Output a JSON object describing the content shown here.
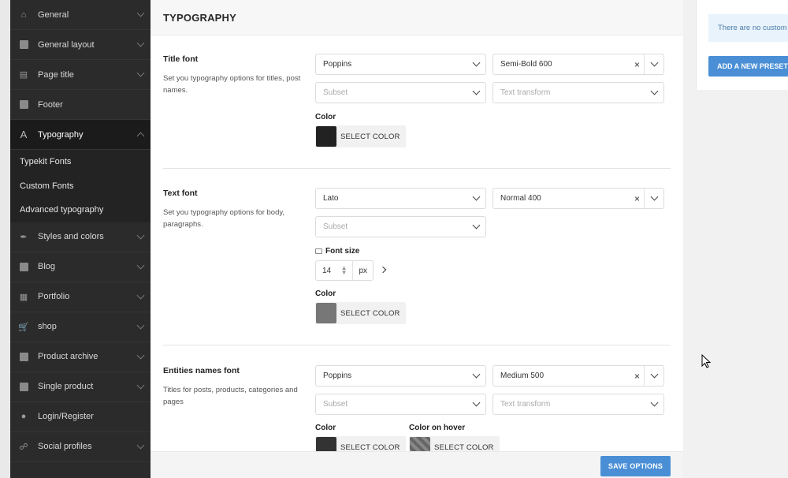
{
  "sidebar": {
    "items": [
      {
        "label": "General",
        "icon": "home-icon"
      },
      {
        "label": "General layout",
        "icon": "layout-icon"
      },
      {
        "label": "Page title",
        "icon": "page-title-icon"
      },
      {
        "label": "Footer",
        "icon": "footer-icon"
      },
      {
        "label": "Typography",
        "icon": "typography-icon"
      },
      {
        "label": "Styles and colors",
        "icon": "brush-icon"
      },
      {
        "label": "Blog",
        "icon": "blog-icon"
      },
      {
        "label": "Portfolio",
        "icon": "portfolio-icon"
      },
      {
        "label": "shop",
        "icon": "cart-icon"
      },
      {
        "label": "Product archive",
        "icon": "store-icon"
      },
      {
        "label": "Single product",
        "icon": "product-icon"
      },
      {
        "label": "Login/Register",
        "icon": "user-icon"
      },
      {
        "label": "Social profiles",
        "icon": "social-icon"
      }
    ],
    "typography_sub": [
      "Typekit Fonts",
      "Custom Fonts",
      "Advanced typography"
    ]
  },
  "main": {
    "title": "TYPOGRAPHY",
    "sections": {
      "title_font": {
        "title": "Title font",
        "desc": "Set you typography options for titles, post names.",
        "family": "Poppins",
        "weight": "Semi-Bold 600",
        "subset_placeholder": "Subset",
        "transform_placeholder": "Text transform",
        "color_label": "Color",
        "color_btn": "SELECT COLOR",
        "color": "#222222"
      },
      "text_font": {
        "title": "Text font",
        "desc": "Set you typography options for body, paragraphs.",
        "family": "Lato",
        "weight": "Normal 400",
        "subset_placeholder": "Subset",
        "font_size_label": "Font size",
        "font_size_value": "14",
        "font_size_unit": "px",
        "color_label": "Color",
        "color_btn": "SELECT COLOR",
        "color": "#777777"
      },
      "entities_font": {
        "title": "Entities names font",
        "desc": "Titles for posts, products, categories and pages",
        "family": "Poppins",
        "weight": "Medium 500",
        "subset_placeholder": "Subset",
        "transform_placeholder": "Text transform",
        "color_label": "Color",
        "color_btn": "SELECT COLOR",
        "color": "#333333",
        "hover_label": "Color on hover",
        "hover_btn": "SELECT COLOR"
      }
    },
    "save_label": "SAVE OPTIONS"
  },
  "presets": {
    "notice": "There are no custom presets yet.",
    "add_label": "ADD A NEW PRESET"
  },
  "colors": {
    "accent": "#4a8fd6",
    "sidebar_bg": "#2b2b2b"
  }
}
